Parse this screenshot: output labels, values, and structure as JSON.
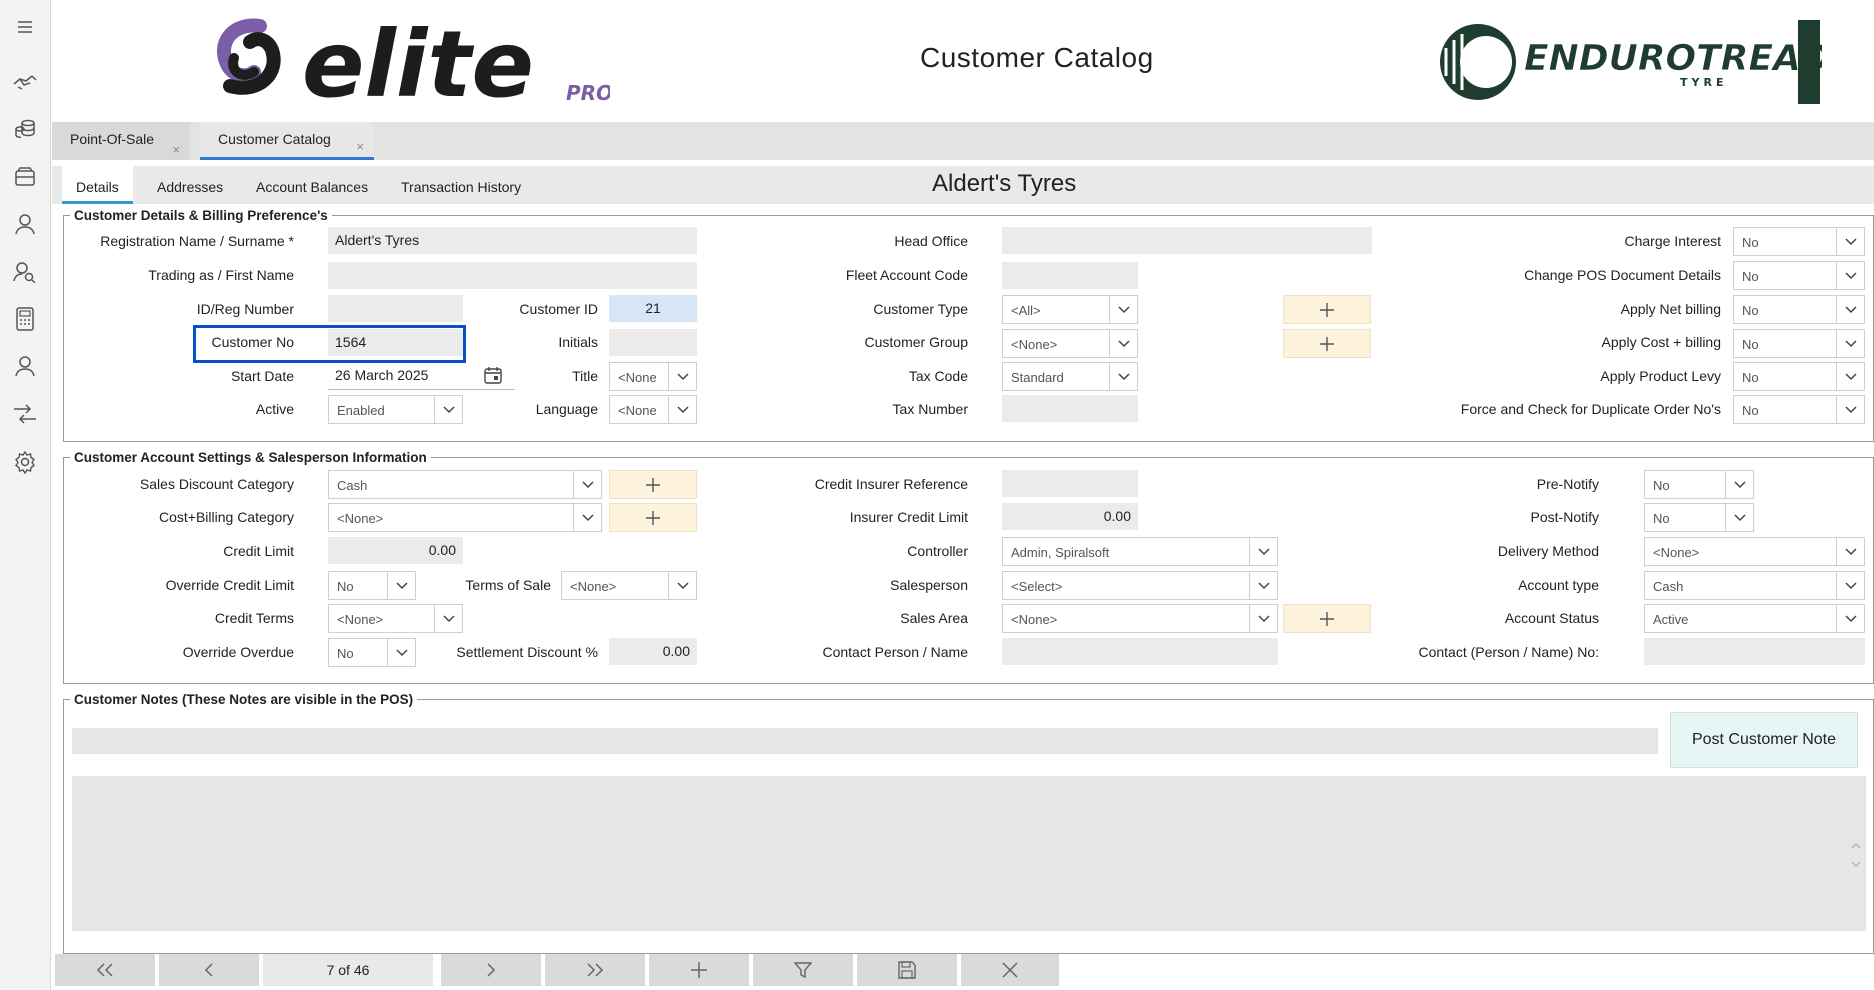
{
  "sidebar": {
    "icons": [
      "menu-icon",
      "handshake-icon",
      "coins-icon",
      "register-icon",
      "user-icon",
      "user-search-icon",
      "calculator-icon",
      "person-icon",
      "transfer-icon",
      "gear-icon"
    ]
  },
  "header": {
    "title": "Customer Catalog",
    "logo_left": "elite",
    "logo_left_sub": "PRO",
    "logo_right": "ENDUROTREAD",
    "logo_right_sub": "TYRE"
  },
  "doc_tabs": [
    {
      "label": "Point-Of-Sale",
      "close": "×"
    },
    {
      "label": "Customer Catalog",
      "close": "×"
    }
  ],
  "inner_tabs": [
    "Details",
    "Addresses",
    "Account Balances",
    "Transaction History"
  ],
  "customer_title": "Aldert's Tyres",
  "section1": {
    "legend": "Customer Details & Billing Preference's",
    "registration_name_label": "Registration Name / Surname *",
    "registration_name": "Aldert's Tyres",
    "trading_as_label": "Trading as / First Name",
    "trading_as": "",
    "id_reg_label": "ID/Reg Number",
    "id_reg": "",
    "customer_id_label": "Customer ID",
    "customer_id": "21",
    "customer_no_label": "Customer No",
    "customer_no": "1564",
    "initials_label": "Initials",
    "initials": "",
    "start_date_label": "Start Date",
    "start_date": "26 March 2025",
    "title_label": "Title",
    "title": "<None",
    "active_label": "Active",
    "active": "Enabled",
    "language_label": "Language",
    "language": "<None",
    "head_office_label": "Head Office",
    "fleet_account_label": "Fleet Account Code",
    "customer_type_label": "Customer Type",
    "customer_type": "<All>",
    "customer_group_label": "Customer Group",
    "customer_group": "<None>",
    "tax_code_label": "Tax Code",
    "tax_code": "Standard",
    "tax_number_label": "Tax Number",
    "charge_interest_label": "Charge Interest",
    "charge_interest": "No",
    "change_pos_label": "Change POS Document Details",
    "change_pos": "No",
    "apply_net_label": "Apply Net billing",
    "apply_net": "No",
    "apply_cost_label": "Apply Cost + billing",
    "apply_cost": "No",
    "apply_levy_label": "Apply Product Levy",
    "apply_levy": "No",
    "force_check_label": "Force and Check for Duplicate Order No's",
    "force_check": "No"
  },
  "section2": {
    "legend": "Customer Account Settings & Salesperson Information",
    "sales_discount_label": "Sales Discount Category",
    "sales_discount": "Cash",
    "cost_billing_label": "Cost+Billing Category",
    "cost_billing": "<None>",
    "credit_limit_label": "Credit Limit",
    "credit_limit": "0.00",
    "override_credit_label": "Override Credit Limit",
    "override_credit": "No",
    "terms_of_sale_label": "Terms of Sale",
    "terms_of_sale": "<None>",
    "credit_terms_label": "Credit Terms",
    "credit_terms": "<None>",
    "override_overdue_label": "Override Overdue",
    "override_overdue": "No",
    "settlement_label": "Settlement Discount %",
    "settlement": "0.00",
    "credit_insurer_label": "Credit Insurer Reference",
    "insurer_limit_label": "Insurer Credit Limit",
    "insurer_limit": "0.00",
    "controller_label": "Controller",
    "controller": "Admin, Spiralsoft",
    "salesperson_label": "Salesperson",
    "salesperson": "<Select>",
    "sales_area_label": "Sales Area",
    "sales_area": "<None>",
    "contact_person_label": "Contact Person / Name",
    "pre_notify_label": "Pre-Notify",
    "pre_notify": "No",
    "post_notify_label": "Post-Notify",
    "post_notify": "No",
    "delivery_method_label": "Delivery Method",
    "delivery_method": "<None>",
    "account_type_label": "Account type",
    "account_type": "Cash",
    "account_status_label": "Account Status",
    "account_status": "Active",
    "contact_no_label": "Contact (Person / Name) No:"
  },
  "notes": {
    "legend": "Customer Notes (These Notes are visible in the POS)",
    "post_button": "Post Customer Note"
  },
  "navigation": {
    "record_position": "7 of 46"
  }
}
